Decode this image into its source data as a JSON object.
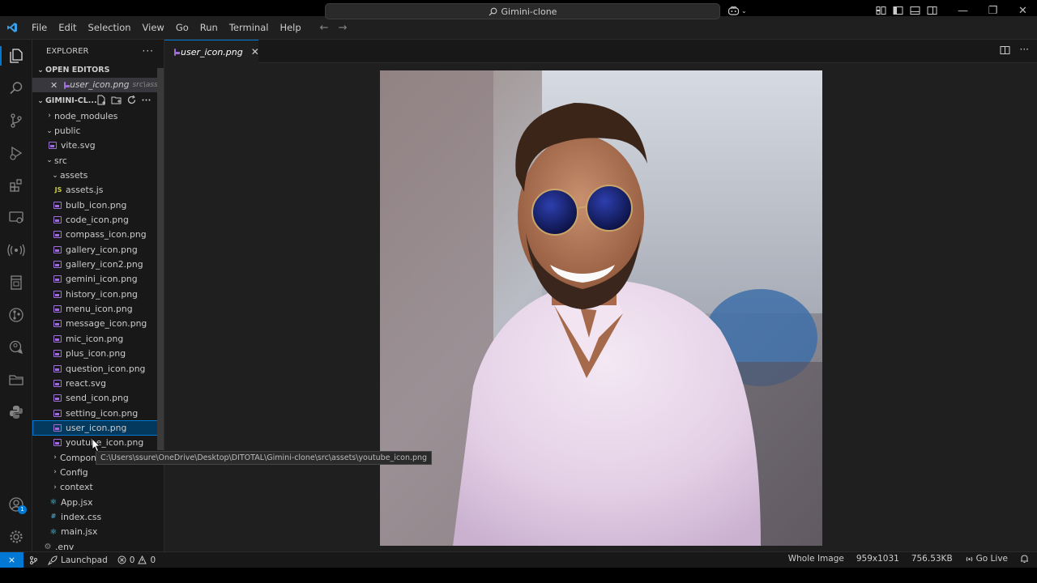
{
  "menu": [
    "File",
    "Edit",
    "Selection",
    "View",
    "Go",
    "Run",
    "Terminal",
    "Help"
  ],
  "command_center": {
    "text": "Gimini-clone"
  },
  "sidebar": {
    "title": "EXPLORER",
    "open_editors": {
      "label": "OPEN EDITORS",
      "items": [
        {
          "name": "user_icon.png",
          "path": "src\\assets"
        }
      ]
    },
    "project": {
      "label": "GIMINI-CL..."
    },
    "tree": [
      {
        "name": "node_modules",
        "kind": "folder",
        "expanded": false,
        "depth": 0
      },
      {
        "name": "public",
        "kind": "folder",
        "expanded": true,
        "depth": 0
      },
      {
        "name": "vite.svg",
        "kind": "svg",
        "depth": 1
      },
      {
        "name": "src",
        "kind": "folder",
        "expanded": true,
        "depth": 0
      },
      {
        "name": "assets",
        "kind": "folder",
        "expanded": true,
        "depth": 1
      },
      {
        "name": "assets.js",
        "kind": "js",
        "depth": 2
      },
      {
        "name": "bulb_icon.png",
        "kind": "img",
        "depth": 2
      },
      {
        "name": "code_icon.png",
        "kind": "img",
        "depth": 2
      },
      {
        "name": "compass_icon.png",
        "kind": "img",
        "depth": 2
      },
      {
        "name": "gallery_icon.png",
        "kind": "img",
        "depth": 2
      },
      {
        "name": "gallery_icon2.png",
        "kind": "img",
        "depth": 2
      },
      {
        "name": "gemini_icon.png",
        "kind": "img",
        "depth": 2
      },
      {
        "name": "history_icon.png",
        "kind": "img",
        "depth": 2
      },
      {
        "name": "menu_icon.png",
        "kind": "img",
        "depth": 2
      },
      {
        "name": "message_icon.png",
        "kind": "img",
        "depth": 2
      },
      {
        "name": "mic_icon.png",
        "kind": "img",
        "depth": 2
      },
      {
        "name": "plus_icon.png",
        "kind": "img",
        "depth": 2
      },
      {
        "name": "question_icon.png",
        "kind": "img",
        "depth": 2
      },
      {
        "name": "react.svg",
        "kind": "svg",
        "depth": 2
      },
      {
        "name": "send_icon.png",
        "kind": "img",
        "depth": 2
      },
      {
        "name": "setting_icon.png",
        "kind": "img",
        "depth": 2
      },
      {
        "name": "user_icon.png",
        "kind": "img",
        "depth": 2,
        "selected": true
      },
      {
        "name": "youtube_icon.png",
        "kind": "img",
        "depth": 2
      },
      {
        "name": "Components",
        "kind": "folder",
        "expanded": false,
        "depth": 1
      },
      {
        "name": "Config",
        "kind": "folder",
        "expanded": false,
        "depth": 1
      },
      {
        "name": "context",
        "kind": "folder",
        "expanded": false,
        "depth": 1
      },
      {
        "name": "App.jsx",
        "kind": "react",
        "depth": 1
      },
      {
        "name": "index.css",
        "kind": "css",
        "depth": 1
      },
      {
        "name": "main.jsx",
        "kind": "react",
        "depth": 1
      },
      {
        "name": ".env",
        "kind": "env",
        "depth": 0
      }
    ]
  },
  "tab": {
    "label": "user_icon.png"
  },
  "tooltip": {
    "text": "C:\\Users\\ssure\\OneDrive\\Desktop\\DITOTAL\\Gimini-clone\\src\\assets\\youtube_icon.png"
  },
  "statusbar": {
    "launchpad": "Launchpad",
    "errors": "0",
    "warnings": "0",
    "zoom_mode": "Whole Image",
    "dimensions": "959x1031",
    "size": "756.53KB",
    "go_live": "Go Live"
  },
  "accounts_badge": "1",
  "colors": {
    "accent": "#0078d4",
    "selection": "#04395e",
    "image_icon": "#9b6fd6",
    "js_icon": "#cbcb41"
  }
}
